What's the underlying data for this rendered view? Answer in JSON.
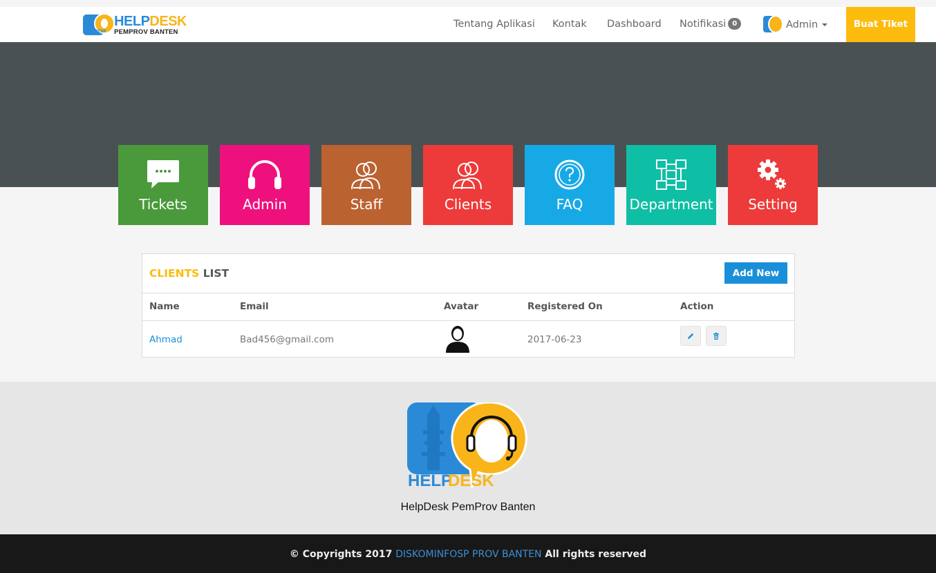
{
  "brand": {
    "title_help": "HELP",
    "title_desk": "DESK",
    "subtitle": "PEMPROV BANTEN",
    "tiny": "HELPDESK"
  },
  "nav": {
    "items": [
      {
        "label": "Tentang Aplikasi"
      },
      {
        "label": "Kontak"
      },
      {
        "label": "Dashboard"
      },
      {
        "label": "Notifikasi"
      }
    ],
    "notif_count": "0",
    "user_label": "Admin",
    "cta_label": "Buat Tiket"
  },
  "tiles": [
    {
      "label": "Tickets",
      "icon": "chat-bubble-icon",
      "color": "#4a9a3b"
    },
    {
      "label": "Admin",
      "icon": "headphones-icon",
      "color": "#ee117d"
    },
    {
      "label": "Staff",
      "icon": "users-icon",
      "color": "#bb6231"
    },
    {
      "label": "Clients",
      "icon": "users-icon",
      "color": "#ec3b3a"
    },
    {
      "label": "FAQ",
      "icon": "question-circle-icon",
      "color": "#17a9e6"
    },
    {
      "label": "Department",
      "icon": "sitemap-icon",
      "color": "#0fbfa5"
    },
    {
      "label": "Setting",
      "icon": "gears-icon",
      "color": "#ec3b3a"
    }
  ],
  "panel": {
    "title_a": "CLIENTS",
    "title_b": "LIST",
    "add_label": "Add New",
    "columns": [
      "Name",
      "Email",
      "Avatar",
      "Registered On",
      "Action"
    ],
    "rows": [
      {
        "name": "Ahmad",
        "email": "Bad456@gmail.com",
        "avatar": "user-silhouette-icon",
        "registered_on": "2017-06-23"
      }
    ]
  },
  "footer": {
    "logo_help": "HELP",
    "logo_desk": "DESK",
    "name": "HelpDesk PemProv Banten",
    "copyright_prefix": "© Copyrights 2017",
    "org": "DISKOMINFOSP PROV BANTEN",
    "rights": "All rights reserved"
  },
  "colors": {
    "accent": "#fdbb0e",
    "primary": "#1a8fd9",
    "hero": "#4a5153"
  }
}
